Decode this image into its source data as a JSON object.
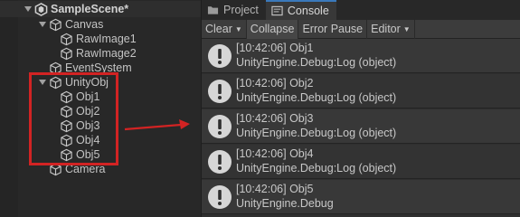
{
  "hierarchy": {
    "scene": "SampleScene*",
    "canvas": "Canvas",
    "rawimage1": "RawImage1",
    "rawimage2": "RawImage2",
    "eventsystem": "EventSystem",
    "unityobj": "UnityObj",
    "obj1": "Obj1",
    "obj2": "Obj2",
    "obj3": "Obj3",
    "obj4": "Obj4",
    "obj5": "Obj5",
    "camera": "Camera"
  },
  "tabs": {
    "project": "Project",
    "console": "Console"
  },
  "toolbar": {
    "clear": "Clear",
    "collapse": "Collapse",
    "error_pause": "Error Pause",
    "editor": "Editor"
  },
  "logs": [
    {
      "line1": "[10:42:06] Obj1",
      "line2": "UnityEngine.Debug:Log (object)"
    },
    {
      "line1": "[10:42:06] Obj2",
      "line2": "UnityEngine.Debug:Log (object)"
    },
    {
      "line1": "[10:42:06] Obj3",
      "line2": "UnityEngine.Debug:Log (object)"
    },
    {
      "line1": "[10:42:06] Obj4",
      "line2": "UnityEngine.Debug:Log (object)"
    },
    {
      "line1": "[10:42:06] Obj5",
      "line2": "UnityEngine.Debug"
    }
  ],
  "colors": {
    "highlight_box": "#d22323",
    "accent_tab": "#3a79bb"
  },
  "icons": {
    "scene": "unity-logo-icon",
    "gameobject": "cube-icon",
    "log": "info-icon"
  }
}
